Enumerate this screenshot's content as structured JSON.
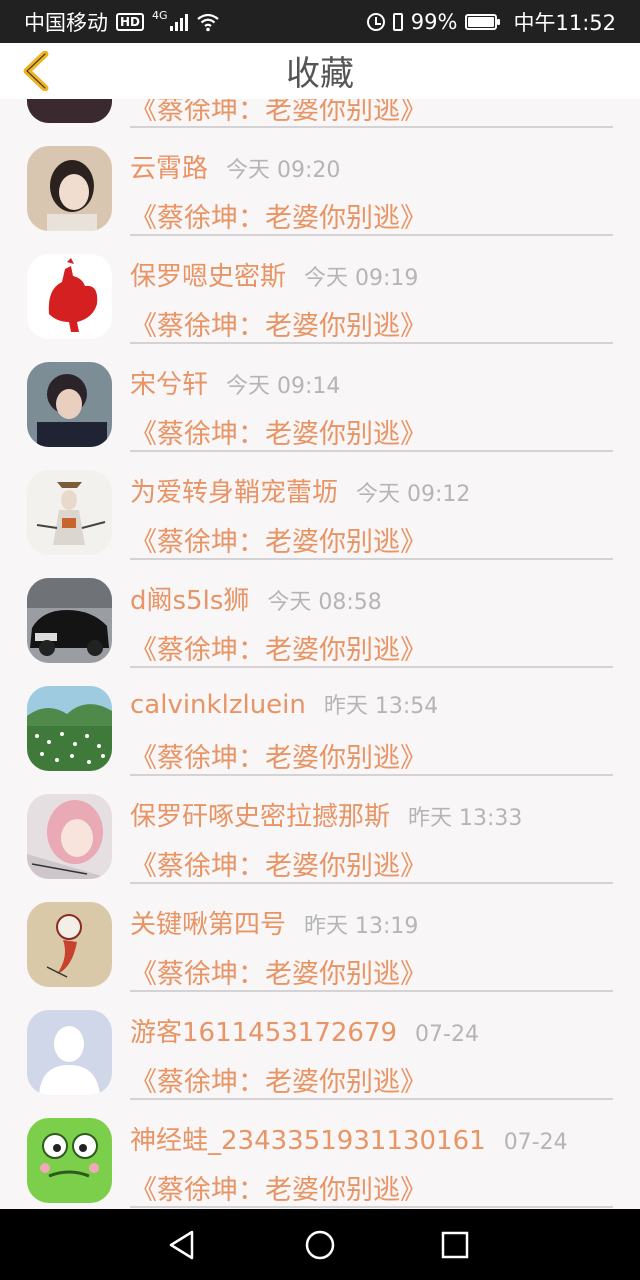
{
  "status_bar": {
    "carrier": "中国移动",
    "hd": "HD",
    "network": "4G",
    "battery": "99%",
    "battery_level": 0.99,
    "time": "中午11:52"
  },
  "header": {
    "title": "收藏",
    "back_icon": "chevron-left-icon",
    "accent_color": "#f0b320"
  },
  "favorites": [
    {
      "name": "",
      "time": "",
      "title": "《蔡徐坤：老婆你别逃》",
      "avatar": "partial-avatar"
    },
    {
      "name": "云霄路",
      "time": "今天 09:20",
      "title": "《蔡徐坤：老婆你别逃》",
      "avatar": "girl-photo"
    },
    {
      "name": "保罗嗯史密斯",
      "time": "今天 09:19",
      "title": "《蔡徐坤：老婆你别逃》",
      "avatar": "red-rooster"
    },
    {
      "name": "宋兮轩",
      "time": "今天 09:14",
      "title": "《蔡徐坤：老婆你别逃》",
      "avatar": "boy-photo"
    },
    {
      "name": "为爱转身鞘宠蕾坜",
      "time": "今天 09:12",
      "title": "《蔡徐坤：老婆你别逃》",
      "avatar": "ink-figure"
    },
    {
      "name": "d阚s5ls狮",
      "time": "今天 08:58",
      "title": "《蔡徐坤：老婆你别逃》",
      "avatar": "black-car"
    },
    {
      "name": "calvinklzluein",
      "time": "昨天 13:54",
      "title": "《蔡徐坤：老婆你别逃》",
      "avatar": "flower-field"
    },
    {
      "name": "保罗矸啄史密拉撼那斯",
      "time": "昨天 13:33",
      "title": "《蔡徐坤：老婆你别逃》",
      "avatar": "pink-hair-girl"
    },
    {
      "name": "关键啾第四号",
      "time": "昨天 13:19",
      "title": "《蔡徐坤：老婆你别逃》",
      "avatar": "cartoon-sketch"
    },
    {
      "name": "游客1611453172679",
      "time": "07-24",
      "title": "《蔡徐坤：老婆你别逃》",
      "avatar": "default-person"
    },
    {
      "name": "神经蛙_2343351931130161",
      "time": "07-24",
      "title": "《蔡徐坤：老婆你别逃》",
      "avatar": "green-frog"
    }
  ],
  "colors": {
    "name_text": "#e89465",
    "time_text": "#b5b5b5",
    "background": "#f8f6f6",
    "divider": "#d4d2d2"
  },
  "nav_bar": {
    "back": "triangle-back-icon",
    "home": "circle-home-icon",
    "recent": "square-recents-icon"
  }
}
